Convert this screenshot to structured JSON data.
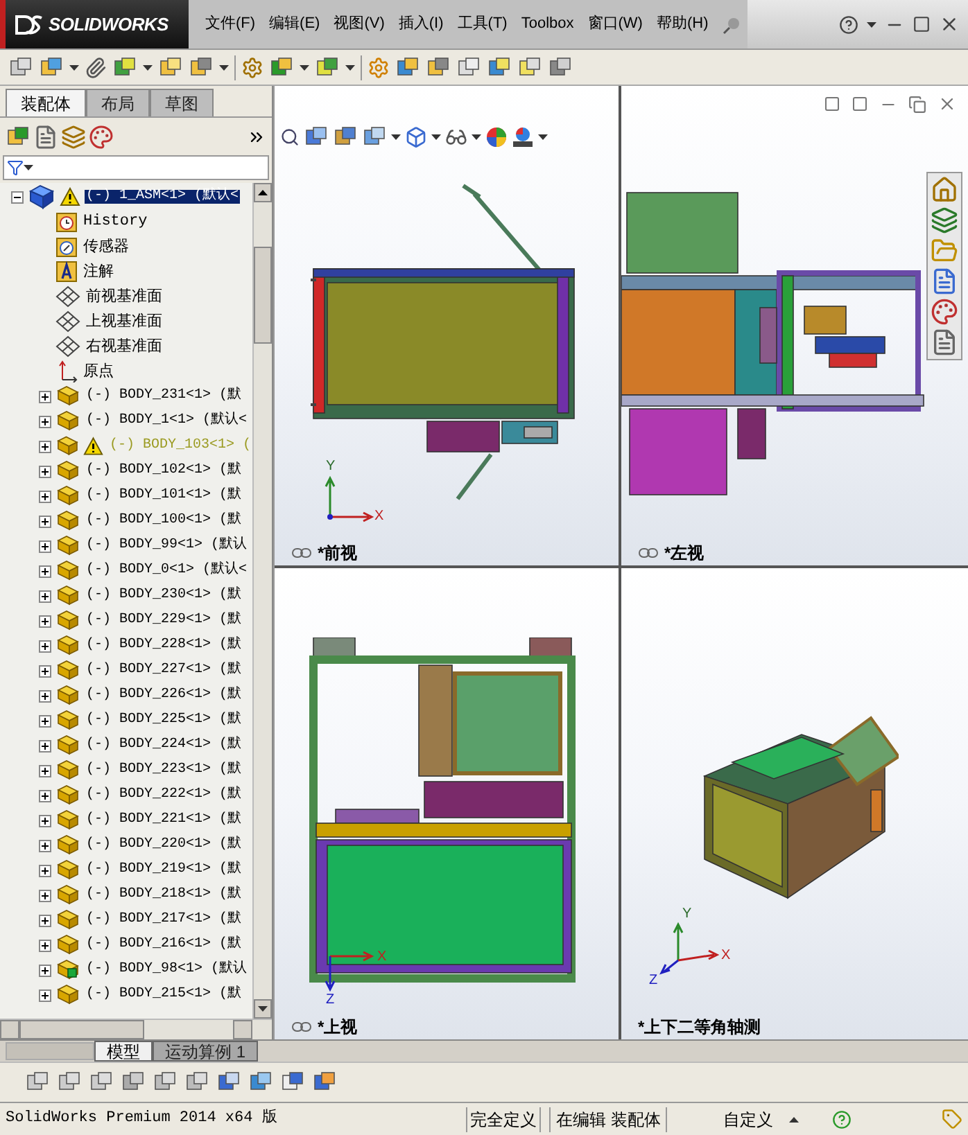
{
  "logo": {
    "text": "SOLIDWORKS"
  },
  "menu": [
    "文件(F)",
    "编辑(E)",
    "视图(V)",
    "插入(I)",
    "工具(T)",
    "Toolbox",
    "窗口(W)",
    "帮助(H)"
  ],
  "panel_tabs": [
    {
      "label": "装配体",
      "selected": true
    },
    {
      "label": "布局",
      "selected": false
    },
    {
      "label": "草图",
      "selected": false
    }
  ],
  "tree": {
    "label": "(-) 1_ASM<1> (默认<",
    "kind": "assembly",
    "warning": true,
    "expanded": true,
    "selected": true,
    "children": [
      {
        "label": "History",
        "kind": "history"
      },
      {
        "label": "传感器",
        "kind": "sensor"
      },
      {
        "label": "注解",
        "kind": "annotation"
      },
      {
        "label": "前视基准面",
        "kind": "plane"
      },
      {
        "label": "上视基准面",
        "kind": "plane"
      },
      {
        "label": "右视基准面",
        "kind": "plane"
      },
      {
        "label": "原点",
        "kind": "origin"
      },
      {
        "label": "(-) BODY_231<1> (默",
        "kind": "part",
        "warning": false,
        "expanded": false
      },
      {
        "label": "(-) BODY_1<1> (默认<",
        "kind": "part",
        "warning": false,
        "expanded": false
      },
      {
        "label": "(-) BODY_103<1> (",
        "kind": "part",
        "warning": true,
        "expanded": false
      },
      {
        "label": "(-) BODY_102<1> (默",
        "kind": "part",
        "warning": false,
        "expanded": false
      },
      {
        "label": "(-) BODY_101<1> (默",
        "kind": "part",
        "warning": false,
        "expanded": false
      },
      {
        "label": "(-) BODY_100<1> (默",
        "kind": "part",
        "warning": false,
        "expanded": false
      },
      {
        "label": "(-) BODY_99<1> (默认",
        "kind": "part",
        "warning": false,
        "expanded": false
      },
      {
        "label": "(-) BODY_0<1> (默认<",
        "kind": "part",
        "warning": false,
        "expanded": false
      },
      {
        "label": "(-) BODY_230<1> (默",
        "kind": "part",
        "warning": false,
        "expanded": false
      },
      {
        "label": "(-) BODY_229<1> (默",
        "kind": "part",
        "warning": false,
        "expanded": false
      },
      {
        "label": "(-) BODY_228<1> (默",
        "kind": "part",
        "warning": false,
        "expanded": false
      },
      {
        "label": "(-) BODY_227<1> (默",
        "kind": "part",
        "warning": false,
        "expanded": false
      },
      {
        "label": "(-) BODY_226<1> (默",
        "kind": "part",
        "warning": false,
        "expanded": false
      },
      {
        "label": "(-) BODY_225<1> (默",
        "kind": "part",
        "warning": false,
        "expanded": false
      },
      {
        "label": "(-) BODY_224<1> (默",
        "kind": "part",
        "warning": false,
        "expanded": false
      },
      {
        "label": "(-) BODY_223<1> (默",
        "kind": "part",
        "warning": false,
        "expanded": false
      },
      {
        "label": "(-) BODY_222<1> (默",
        "kind": "part",
        "warning": false,
        "expanded": false
      },
      {
        "label": "(-) BODY_221<1> (默",
        "kind": "part",
        "warning": false,
        "expanded": false
      },
      {
        "label": "(-) BODY_220<1> (默",
        "kind": "part",
        "warning": false,
        "expanded": false
      },
      {
        "label": "(-) BODY_219<1> (默",
        "kind": "part",
        "warning": false,
        "expanded": false
      },
      {
        "label": "(-) BODY_218<1> (默",
        "kind": "part",
        "warning": false,
        "expanded": false
      },
      {
        "label": "(-) BODY_217<1> (默",
        "kind": "part",
        "warning": false,
        "expanded": false
      },
      {
        "label": "(-) BODY_216<1> (默",
        "kind": "part",
        "warning": false,
        "expanded": false
      },
      {
        "label": "(-) BODY_98<1> (默认",
        "kind": "subassembly",
        "warning": false,
        "expanded": false
      },
      {
        "label": "(-) BODY_215<1> (默",
        "kind": "part",
        "warning": false,
        "expanded": false
      }
    ]
  },
  "views": [
    {
      "label": "*前视",
      "kind": "front",
      "linked": true,
      "axes": [
        "Y",
        "X"
      ]
    },
    {
      "label": "*左视",
      "kind": "left",
      "linked": true
    },
    {
      "label": "*上视",
      "kind": "top",
      "linked": true,
      "axes": [
        "X",
        "Z"
      ]
    },
    {
      "label": "*上下二等角轴测",
      "kind": "iso",
      "linked": false,
      "axes": [
        "Y",
        "X",
        "Z"
      ]
    }
  ],
  "bottom_tabs": [
    {
      "label": "模型",
      "selected": true
    },
    {
      "label": "运动算例 1",
      "selected": false
    }
  ],
  "status_bar": {
    "product": "SolidWorks Premium 2014 x64 版",
    "state": "完全定义",
    "mode": "在编辑 装配体",
    "units": "自定义"
  }
}
